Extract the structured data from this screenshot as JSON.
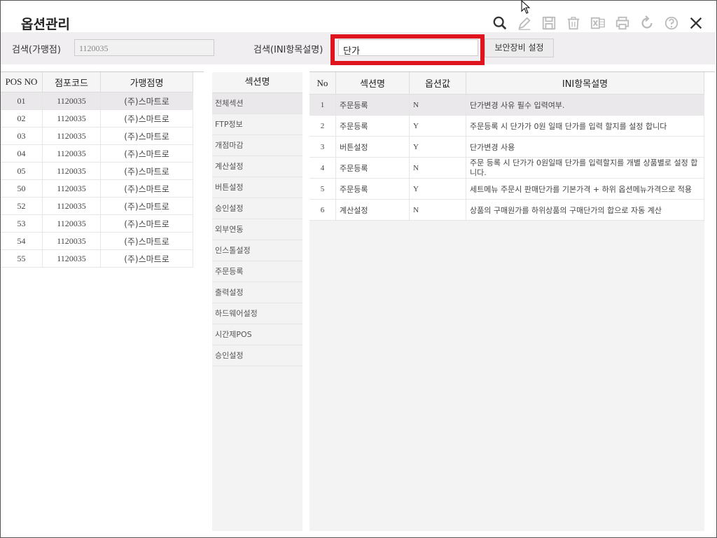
{
  "title": "옵션관리",
  "toolbar": {
    "icons": [
      "search-icon",
      "edit-icon",
      "save-icon",
      "delete-icon",
      "excel-icon",
      "print-icon",
      "refresh-icon",
      "help-icon",
      "close-icon"
    ]
  },
  "search": {
    "store_label": "검색(가맹점)",
    "store_value": "1120035",
    "ini_label": "검색(INI항목설명)",
    "ini_value": "단가",
    "security_button": "보안장비 설정"
  },
  "left_table": {
    "headers": [
      "POS NO",
      "점포코드",
      "가맹점명"
    ],
    "rows": [
      [
        "01",
        "1120035",
        "(주)스마트로"
      ],
      [
        "02",
        "1120035",
        "(주)스마트로"
      ],
      [
        "03",
        "1120035",
        "(주)스마트로"
      ],
      [
        "04",
        "1120035",
        "(주)스마트로"
      ],
      [
        "05",
        "1120035",
        "(주)스마트로"
      ],
      [
        "50",
        "1120035",
        "(주)스마트로"
      ],
      [
        "52",
        "1120035",
        "(주)스마트로"
      ],
      [
        "53",
        "1120035",
        "(주)스마트로"
      ],
      [
        "54",
        "1120035",
        "(주)스마트로"
      ],
      [
        "55",
        "1120035",
        "(주)스마트로"
      ]
    ]
  },
  "section_list": {
    "header": "섹션명",
    "items": [
      "전체섹션",
      "FTP정보",
      "개점마감",
      "계산설정",
      "버튼설정",
      "승인설정",
      "외부연동",
      "인스톨설정",
      "주문등록",
      "출력설정",
      "하드웨어설정",
      "시간제POS",
      "승인설정"
    ]
  },
  "option_table": {
    "headers": [
      "No",
      "섹션명",
      "옵션값",
      "INI항목설명"
    ],
    "rows": [
      [
        "1",
        "주문등록",
        "N",
        "단가변경 사유 필수 입력여부."
      ],
      [
        "2",
        "주문등록",
        "Y",
        "주문등록 시 단가가 0원 일때 단가를 입력 할지를 설정 합니다"
      ],
      [
        "3",
        "버튼설정",
        "Y",
        "단가변경 사용"
      ],
      [
        "4",
        "주문등록",
        "N",
        "주문 등록 시 단가가 0원일때 단가를 입력할지를 개별 상품별로 설정 합니다."
      ],
      [
        "5",
        "주문등록",
        "Y",
        "세트메뉴 주문시 판매단가를 기본가격 + 하위 옵션메뉴가격으로 적용"
      ],
      [
        "6",
        "계산설정",
        "N",
        "상품의 구매원가를 하위상품의 구매단가의 합으로 자동 계산"
      ]
    ]
  },
  "colors": {
    "highlight": "#e0141e",
    "selected_row": "#ebe8eb",
    "search_bar": "#f1eef1"
  }
}
